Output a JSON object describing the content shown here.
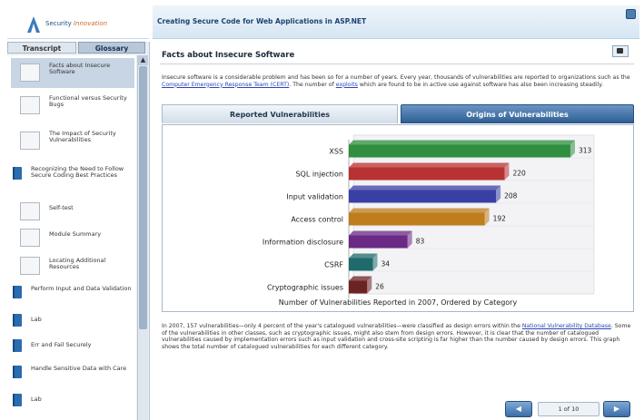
{
  "app": {
    "brand_primary": "Security",
    "brand_secondary": "Innovation",
    "course_title": "Creating Secure Code for Web Applications in ASP.NET"
  },
  "sidebar": {
    "tabs": [
      {
        "label": "Transcript",
        "selected": false
      },
      {
        "label": "Glossary",
        "selected": true
      }
    ],
    "items": [
      {
        "label": "Facts about Insecure Software",
        "kind": "page",
        "selected": true
      },
      {
        "label": "Functional versus Security Bugs",
        "kind": "page",
        "selected": false
      },
      {
        "label": "The Impact of Security Vulnerabilities",
        "kind": "page",
        "selected": false
      },
      {
        "label": "Recognizing the Need to Follow Secure Coding Best Practices",
        "kind": "page",
        "selected": false
      },
      {
        "label": "Self-test",
        "kind": "page",
        "selected": false
      },
      {
        "label": "Module Summary",
        "kind": "page",
        "selected": false
      },
      {
        "label": "Locating Additional Resources",
        "kind": "page",
        "selected": false
      },
      {
        "label": "Perform Input and Data Validation",
        "kind": "section",
        "selected": false
      },
      {
        "label": "Lab",
        "kind": "section",
        "selected": false
      },
      {
        "label": "Err and Fail Securely",
        "kind": "section",
        "selected": false
      },
      {
        "label": "Handle Sensitive Data with Care",
        "kind": "section",
        "selected": false
      },
      {
        "label": "Lab",
        "kind": "section",
        "selected": false
      }
    ]
  },
  "main": {
    "page_title": "Facts about Insecure Software",
    "intro": {
      "text_before": "Insecure software is a considerable problem and has been so for a number of years. Every year, thousands of vulnerabilities are reported to organizations such as the ",
      "link1": "Computer Emergency Response Team (CERT)",
      "text_middle": ". The number of ",
      "link2": "exploits",
      "text_after": " which are found to be in active use against software has also been increasing steadily."
    },
    "chart_tabs": [
      {
        "label": "Reported Vulnerabilities",
        "selected": false
      },
      {
        "label": "Origins of Vulnerabilities",
        "selected": true
      }
    ],
    "caption": {
      "text_before": "In 2007, 157 vulnerabilities—only 4 percent of the year's catalogued vulnerabilities—were classified as design errors within the ",
      "link": "National Vulnerability Database",
      "text_after": ". Some of the vulnerabilities in other classes, such as cryptographic issues, might also stem from design errors. However, it is clear that the number of catalogued vulnerabilities caused by implementation errors such as input validation and cross-site scripting is far higher than the number caused by design errors. This graph shows the total number of catalogued vulnerabilities for each different category."
    },
    "pager": {
      "prev_label": "◀",
      "next_label": "▶",
      "counter": "1 of 10"
    }
  },
  "chart_data": {
    "type": "bar",
    "orientation": "horizontal",
    "title": "",
    "xlabel": "Number of Vulnerabilities Reported in 2007, Ordered by Category",
    "ylabel": "",
    "categories": [
      "XSS",
      "SQL injection",
      "Input validation",
      "Access control",
      "Information disclosure",
      "CSRF",
      "Cryptographic issues"
    ],
    "values": [
      313,
      220,
      208,
      192,
      83,
      34,
      26
    ],
    "colors": [
      "#2f8f3e",
      "#b83232",
      "#3a3fa6",
      "#c07d1e",
      "#6b2a85",
      "#1f6b6b",
      "#6d2323"
    ],
    "xlim": [
      0,
      340
    ],
    "grid": false,
    "legend": "none"
  }
}
